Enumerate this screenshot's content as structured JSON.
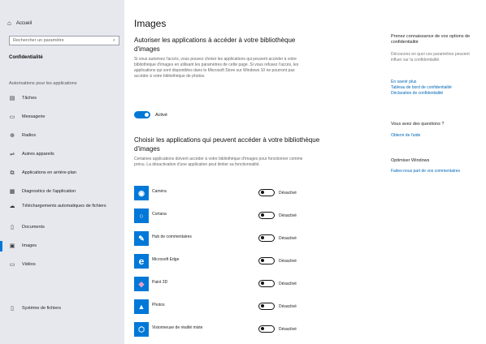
{
  "sidebar": {
    "home": "Accueil",
    "search_placeholder": "Rechercher un paramètre",
    "section": "Confidentialité",
    "group": "Autorisations pour les applications",
    "items": [
      {
        "label": "Tâches",
        "icon": "tasks-icon",
        "glyph": "▤"
      },
      {
        "label": "Messagerie",
        "icon": "message-icon",
        "glyph": "▭"
      },
      {
        "label": "Radios",
        "icon": "radio-icon",
        "glyph": "⊕"
      },
      {
        "label": "Autres appareils",
        "icon": "devices-icon",
        "glyph": "⇌"
      },
      {
        "label": "Applications en arrière-plan",
        "icon": "background-apps-icon",
        "glyph": "⧉"
      },
      {
        "label": "Diagnostics de l'application",
        "icon": "diagnostics-icon",
        "glyph": "▦"
      },
      {
        "label": "Téléchargements automatiques de fichiers",
        "icon": "download-icon",
        "glyph": "☁"
      },
      {
        "label": "Documents",
        "icon": "document-icon",
        "glyph": "▯"
      },
      {
        "label": "Images",
        "icon": "image-icon",
        "glyph": "▣"
      },
      {
        "label": "Vidéos",
        "icon": "video-icon",
        "glyph": "▭"
      },
      {
        "label": "Système de fichiers",
        "icon": "file-system-icon",
        "glyph": "▯"
      }
    ]
  },
  "main": {
    "title": "Images",
    "allow_heading": "Autoriser les applications à accéder à votre bibliothèque d'images",
    "allow_desc": "Si vous autorisez l'accès, vous pouvez choisir les applications qui peuvent accéder à votre bibliothèque d'images en utilisant les paramètres de cette page. Si vous refusez l'accès, les applications qui sont disponibles dans le Microsoft Store sur Windows 10 ne pourront pas accéder à votre bibliothèque de photos.",
    "toggle_label": "Activé",
    "choose_heading": "Choisir les applications qui peuvent accéder à votre bibliothèque d'images",
    "choose_desc": "Certaines applications doivent accéder à votre bibliothèque d'images pour fonctionner comme prévu. La désactivation d'une application peut limiter sa fonctionnalité.",
    "apps": [
      {
        "name": "Caméra",
        "status": "Désactivé",
        "icon": "camera-icon",
        "glyph": "◉"
      },
      {
        "name": "Cortana",
        "status": "Désactivé",
        "icon": "cortana-icon",
        "glyph": "○"
      },
      {
        "name": "Hub de commentaires",
        "status": "Désactivé",
        "icon": "feedback-hub-icon",
        "glyph": "✎"
      },
      {
        "name": "Microsoft Edge",
        "status": "Désactivé",
        "icon": "edge-icon",
        "glyph": "e"
      },
      {
        "name": "Paint 3D",
        "status": "Désactivé",
        "icon": "paint3d-icon",
        "glyph": "◆"
      },
      {
        "name": "Photos",
        "status": "Désactivé",
        "icon": "photos-icon",
        "glyph": "▲"
      },
      {
        "name": "Visionneuse de réalité mixte",
        "status": "Désactivé",
        "icon": "mixed-reality-icon",
        "glyph": "⬡"
      }
    ]
  },
  "right": {
    "know_heading": "Prenez connaissance de vos options de confidentialité",
    "know_desc": "Découvrez en quoi ces paramètres peuvent influer sur la confidentialité.",
    "links": [
      "En savoir plus",
      "Tableau de bord de confidentialité",
      "Déclaration de confidentialité"
    ],
    "questions_heading": "Vous avez des questions ?",
    "help_link": "Obtenir de l'aide",
    "improve_heading": "Optimiser Windows",
    "feedback_link": "Faites-nous part de vos commentaires"
  },
  "colors": {
    "accent": "#0078d7",
    "sidebar_bg": "#e6e8ee",
    "link": "#0067b8"
  }
}
